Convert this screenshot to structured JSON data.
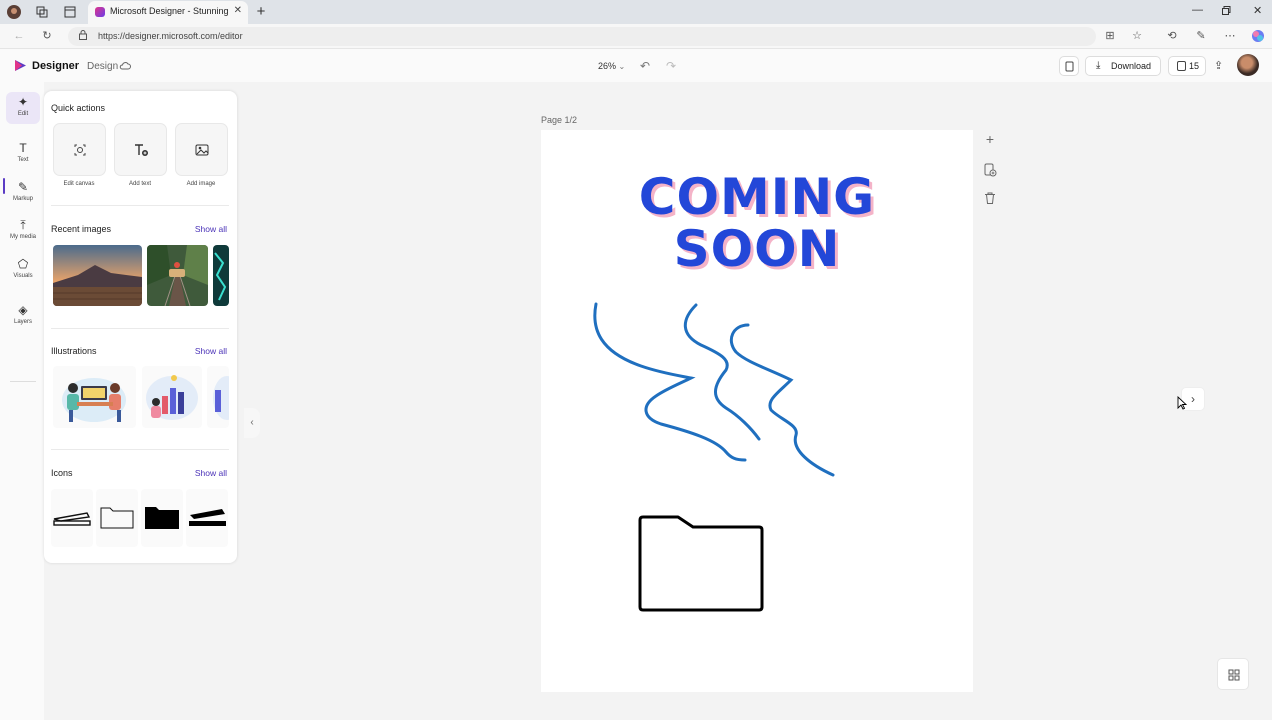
{
  "browser": {
    "tab_title": "Microsoft Designer - Stunning designs",
    "url": "https://designer.microsoft.com/editor"
  },
  "header": {
    "brand": "Designer",
    "mode": "Design",
    "zoom": "26%",
    "download_label": "Download",
    "credits": "15"
  },
  "rail": {
    "items": [
      {
        "label": "Edit",
        "icon": "sparkle-icon"
      },
      {
        "label": "Text",
        "icon": "text-icon"
      },
      {
        "label": "Markup",
        "icon": "pen-icon"
      },
      {
        "label": "My media",
        "icon": "upload-icon"
      },
      {
        "label": "Visuals",
        "icon": "shapes-icon"
      },
      {
        "label": "Layers",
        "icon": "layers-icon"
      }
    ]
  },
  "panel": {
    "quick_actions_title": "Quick actions",
    "quick_actions": [
      {
        "label": "Edit canvas"
      },
      {
        "label": "Add text"
      },
      {
        "label": "Add image"
      }
    ],
    "recent_images_title": "Recent images",
    "illustrations_title": "Illustrations",
    "icons_title": "Icons",
    "show_all": "Show all"
  },
  "canvas": {
    "page_label": "Page 1/2",
    "heading_line1": "COMING",
    "heading_line2": "SOON"
  },
  "colors": {
    "accent": "#4b33b8",
    "heading": "#2347d8",
    "heading_shadow": "#f4b3c8",
    "scribble": "#1f6fbf"
  }
}
